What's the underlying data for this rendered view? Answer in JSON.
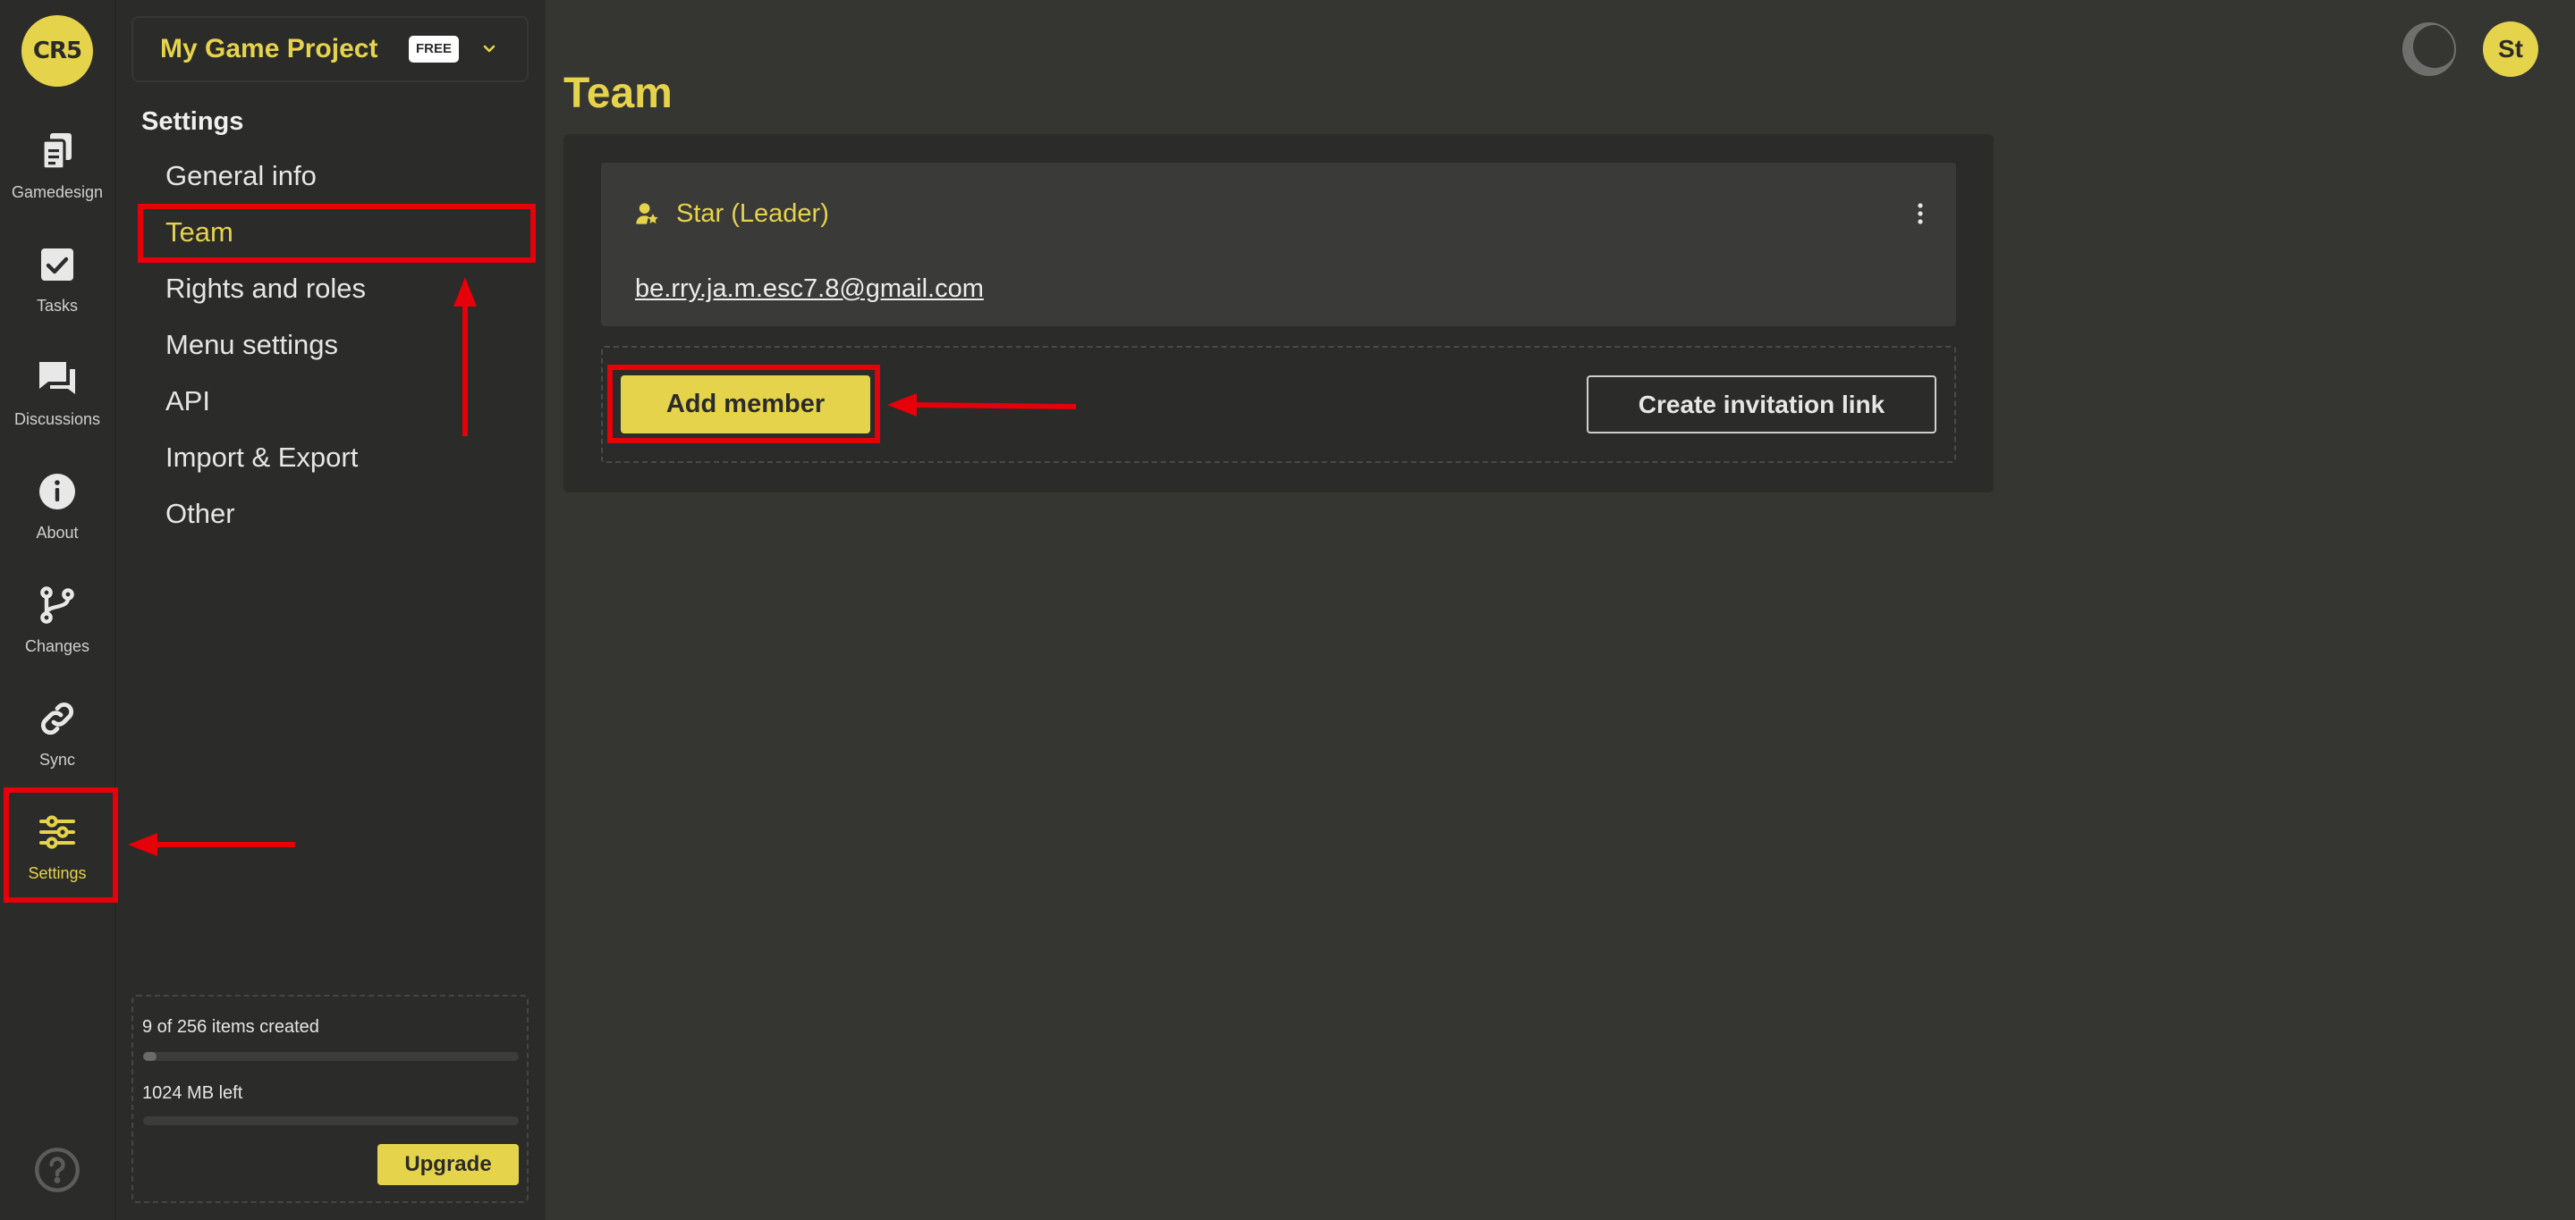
{
  "logo": {
    "text": "CR5"
  },
  "rail": {
    "active_index": 6,
    "items": [
      {
        "label": "Gamedesign",
        "icon": "gamedesign-icon"
      },
      {
        "label": "Tasks",
        "icon": "tasks-icon"
      },
      {
        "label": "Discussions",
        "icon": "discussions-icon"
      },
      {
        "label": "About",
        "icon": "about-icon"
      },
      {
        "label": "Changes",
        "icon": "changes-icon"
      },
      {
        "label": "Sync",
        "icon": "sync-icon"
      },
      {
        "label": "Settings",
        "icon": "settings-icon"
      }
    ],
    "help_icon": "help-icon"
  },
  "project": {
    "name": "My Game Project",
    "plan_badge": "FREE"
  },
  "settings_menu": {
    "heading": "Settings",
    "active_index": 1,
    "items": [
      {
        "label": "General info"
      },
      {
        "label": "Team"
      },
      {
        "label": "Rights and roles"
      },
      {
        "label": "Menu settings"
      },
      {
        "label": "API"
      },
      {
        "label": "Import & Export"
      },
      {
        "label": "Other"
      }
    ]
  },
  "usage": {
    "items_text": "9 of 256 items created",
    "items_fraction": 0.035,
    "storage_text": "1024 MB left",
    "storage_used_fraction": 0,
    "upgrade_label": "Upgrade"
  },
  "header": {
    "theme_toggle_icon": "moon-icon",
    "avatar_initials": "St"
  },
  "page": {
    "title": "Team"
  },
  "team": {
    "members": [
      {
        "name": "Star (Leader)",
        "email": "be.rry.ja.m.esc7.8@gmail.com",
        "icon": "leader-icon"
      }
    ],
    "add_member_label": "Add member",
    "invite_link_label": "Create invitation link"
  },
  "colors": {
    "accent": "#e5d34b",
    "background": "#353532",
    "annotation": "#e5000a"
  }
}
